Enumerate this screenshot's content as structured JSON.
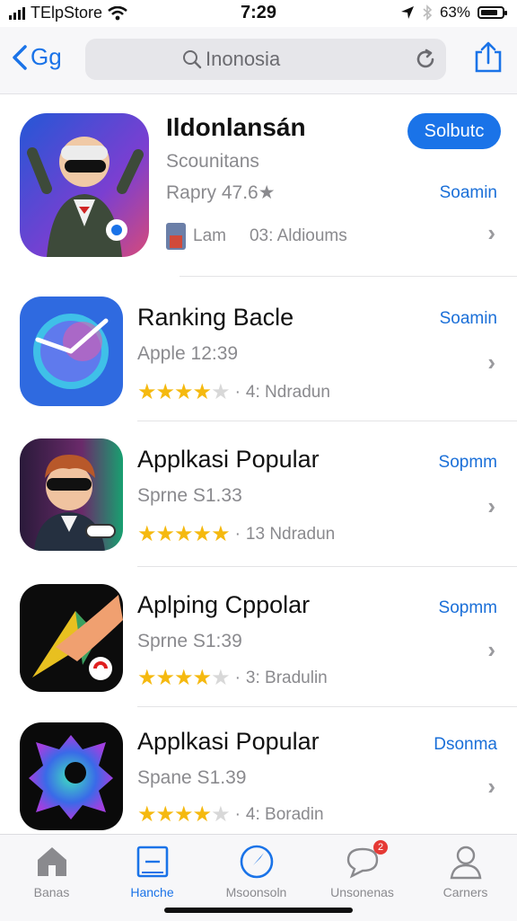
{
  "status": {
    "carrier": "TElpStore",
    "time": "7:29",
    "battery": "63%"
  },
  "nav": {
    "back_label": "Gg",
    "search_text": "Inonosia"
  },
  "featured": {
    "name": "Ildonlansán",
    "subtitle": "Scounitans",
    "rating_text": "Rapry 47.6★",
    "button": "Solbutc",
    "link": "Soamin",
    "meta_a": "Lam",
    "meta_b": "03: Aldioums"
  },
  "apps": [
    {
      "name": "Ranking Bacle",
      "sub": "Apple 12:39",
      "stars": 4,
      "rating_text": "4:  Ndradun",
      "link": "Soamin"
    },
    {
      "name": "Applkasi Popular",
      "sub": "Sprne S1.33",
      "stars": 5,
      "rating_text": "13  Ndradun",
      "link": "Sopmm"
    },
    {
      "name": "Aplping Cppolar",
      "sub": "Sprne S1:39",
      "stars": 4,
      "rating_text": "3:  Bradulin",
      "link": "Sopmm"
    },
    {
      "name": "Applkasi Popular",
      "sub": "Spane S1.39",
      "stars": 4,
      "rating_text": "4:  Boradin",
      "link": "Dsonma"
    }
  ],
  "tabs": [
    {
      "label": "Banas",
      "icon": "home-icon"
    },
    {
      "label": "Hanche",
      "icon": "list-icon"
    },
    {
      "label": "Msoonsoln",
      "icon": "compass-icon"
    },
    {
      "label": "Unsonenas",
      "icon": "chat-icon",
      "badge": "2"
    },
    {
      "label": "Carners",
      "icon": "person-icon"
    }
  ],
  "colors": {
    "accent": "#1a73e8",
    "star": "#f5b90f",
    "badge": "#e53935"
  }
}
